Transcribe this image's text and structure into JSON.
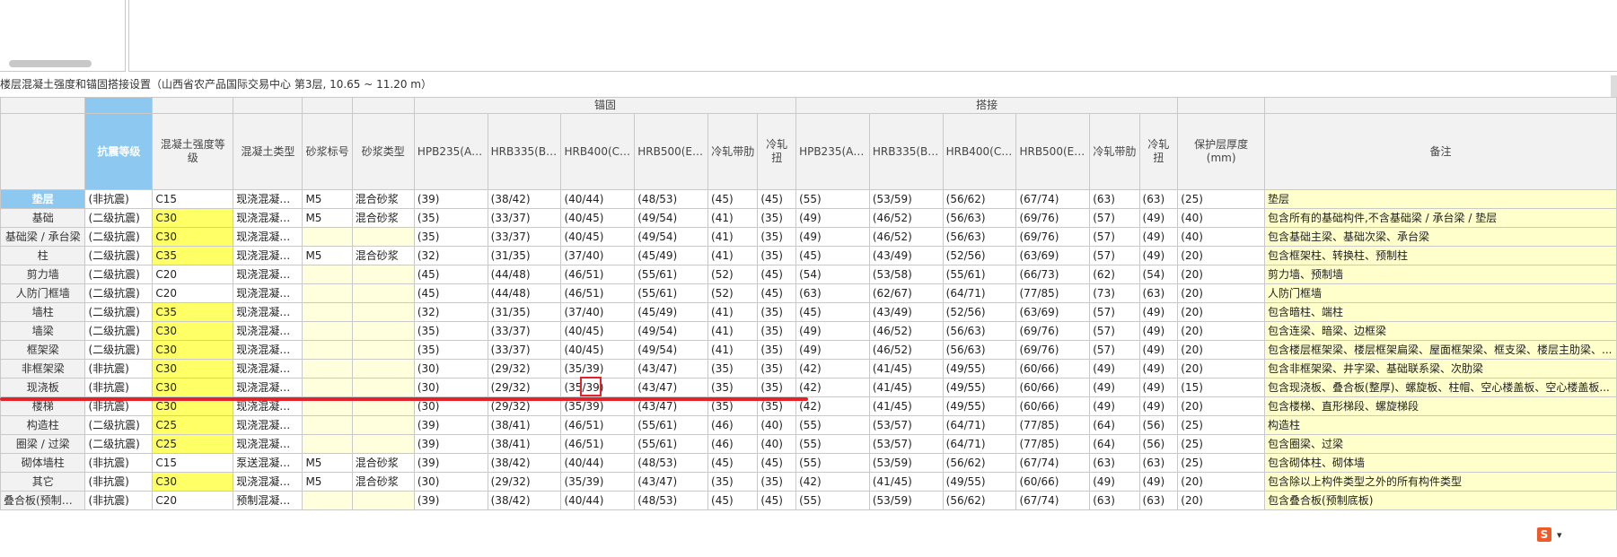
{
  "caption": "楼层混凝土强度和锚固搭接设置（山西省农产品国际交易中心  第3层, 10.65 ~ 11.20 m）",
  "headers": {
    "anchor_group": "锚固",
    "lap_group": "搭接",
    "seismic": "抗震等级",
    "concrete_grade": "混凝土强度等级",
    "concrete_type": "混凝土类型",
    "mortar_grade": "砂浆标号",
    "mortar_type": "砂浆类型",
    "anchor_cols": [
      "HPB235(A)...",
      "HRB335(B)...",
      "HRB400(C)...",
      "HRB500(E)...",
      "冷轧带肋",
      "冷轧扭"
    ],
    "lap_cols": [
      "HPB235(A)...",
      "HRB335(B)...",
      "HRB400(C)...",
      "HRB500(E)...",
      "冷轧带肋",
      "冷轧扭"
    ],
    "cover": "保护层厚度(mm)",
    "note": "备注"
  },
  "rows": [
    {
      "name": "垫层",
      "seismic": "(非抗震)",
      "grade": "C15",
      "ctype": "现浇混凝土...",
      "mortar": "M5",
      "mtype": "混合砂浆",
      "anchor": [
        "(39)",
        "(38/42)",
        "(40/44)",
        "(48/53)",
        "(45)",
        "(45)"
      ],
      "lap": [
        "(55)",
        "(53/59)",
        "(56/62)",
        "(67/74)",
        "(63)",
        "(63)"
      ],
      "cover": "(25)",
      "note": "垫层"
    },
    {
      "name": "基础",
      "seismic": "(二级抗震)",
      "grade": "C30",
      "ctype": "现浇混凝土...",
      "mortar": "M5",
      "mtype": "混合砂浆",
      "anchor": [
        "(35)",
        "(33/37)",
        "(40/45)",
        "(49/54)",
        "(41)",
        "(35)"
      ],
      "lap": [
        "(49)",
        "(46/52)",
        "(56/63)",
        "(69/76)",
        "(57)",
        "(49)"
      ],
      "cover": "(40)",
      "note": "包含所有的基础构件,不含基础梁 / 承台梁 / 垫层"
    },
    {
      "name": "基础梁 / 承台梁",
      "seismic": "(二级抗震)",
      "grade": "C30",
      "ctype": "现浇混凝土...",
      "mortar": "",
      "mtype": "",
      "anchor": [
        "(35)",
        "(33/37)",
        "(40/45)",
        "(49/54)",
        "(41)",
        "(35)"
      ],
      "lap": [
        "(49)",
        "(46/52)",
        "(56/63)",
        "(69/76)",
        "(57)",
        "(49)"
      ],
      "cover": "(40)",
      "note": "包含基础主梁、基础次梁、承台梁"
    },
    {
      "name": "柱",
      "seismic": "(二级抗震)",
      "grade": "C35",
      "ctype": "现浇混凝土...",
      "mortar": "M5",
      "mtype": "混合砂浆",
      "anchor": [
        "(32)",
        "(31/35)",
        "(37/40)",
        "(45/49)",
        "(41)",
        "(35)"
      ],
      "lap": [
        "(45)",
        "(43/49)",
        "(52/56)",
        "(63/69)",
        "(57)",
        "(49)"
      ],
      "cover": "(20)",
      "note": "包含框架柱、转换柱、预制柱"
    },
    {
      "name": "剪力墙",
      "seismic": "(二级抗震)",
      "grade": "C20",
      "ctype": "现浇混凝土...",
      "mortar": "",
      "mtype": "",
      "anchor": [
        "(45)",
        "(44/48)",
        "(46/51)",
        "(55/61)",
        "(52)",
        "(45)"
      ],
      "lap": [
        "(54)",
        "(53/58)",
        "(55/61)",
        "(66/73)",
        "(62)",
        "(54)"
      ],
      "cover": "(20)",
      "note": "剪力墙、预制墙"
    },
    {
      "name": "人防门框墙",
      "seismic": "(二级抗震)",
      "grade": "C20",
      "ctype": "现浇混凝土...",
      "mortar": "",
      "mtype": "",
      "anchor": [
        "(45)",
        "(44/48)",
        "(46/51)",
        "(55/61)",
        "(52)",
        "(45)"
      ],
      "lap": [
        "(63)",
        "(62/67)",
        "(64/71)",
        "(77/85)",
        "(73)",
        "(63)"
      ],
      "cover": "(20)",
      "note": "人防门框墙"
    },
    {
      "name": "墙柱",
      "seismic": "(二级抗震)",
      "grade": "C35",
      "ctype": "现浇混凝土...",
      "mortar": "",
      "mtype": "",
      "anchor": [
        "(32)",
        "(31/35)",
        "(37/40)",
        "(45/49)",
        "(41)",
        "(35)"
      ],
      "lap": [
        "(45)",
        "(43/49)",
        "(52/56)",
        "(63/69)",
        "(57)",
        "(49)"
      ],
      "cover": "(20)",
      "note": "包含暗柱、端柱"
    },
    {
      "name": "墙梁",
      "seismic": "(二级抗震)",
      "grade": "C30",
      "ctype": "现浇混凝土...",
      "mortar": "",
      "mtype": "",
      "anchor": [
        "(35)",
        "(33/37)",
        "(40/45)",
        "(49/54)",
        "(41)",
        "(35)"
      ],
      "lap": [
        "(49)",
        "(46/52)",
        "(56/63)",
        "(69/76)",
        "(57)",
        "(49)"
      ],
      "cover": "(20)",
      "note": "包含连梁、暗梁、边框梁"
    },
    {
      "name": "框架梁",
      "seismic": "(二级抗震)",
      "grade": "C30",
      "ctype": "现浇混凝土...",
      "mortar": "",
      "mtype": "",
      "anchor": [
        "(35)",
        "(33/37)",
        "(40/45)",
        "(49/54)",
        "(41)",
        "(35)"
      ],
      "lap": [
        "(49)",
        "(46/52)",
        "(56/63)",
        "(69/76)",
        "(57)",
        "(49)"
      ],
      "cover": "(20)",
      "note": "包含楼层框架梁、楼层框架扁梁、屋面框架梁、框支梁、楼层主肋梁、..."
    },
    {
      "name": "非框架梁",
      "seismic": "(非抗震)",
      "grade": "C30",
      "ctype": "现浇混凝土...",
      "mortar": "",
      "mtype": "",
      "anchor": [
        "(30)",
        "(29/32)",
        "(35/39)",
        "(43/47)",
        "(35)",
        "(35)"
      ],
      "lap": [
        "(42)",
        "(41/45)",
        "(49/55)",
        "(60/66)",
        "(49)",
        "(49)"
      ],
      "cover": "(20)",
      "note": "包含非框架梁、井字梁、基础联系梁、次肋梁"
    },
    {
      "name": "现浇板",
      "seismic": "(非抗震)",
      "grade": "C30",
      "ctype": "现浇混凝土...",
      "mortar": "",
      "mtype": "",
      "anchor": [
        "(30)",
        "(29/32)",
        "(35/39)",
        "(43/47)",
        "(35)",
        "(35)"
      ],
      "lap": [
        "(42)",
        "(41/45)",
        "(49/55)",
        "(60/66)",
        "(49)",
        "(49)"
      ],
      "cover": "(15)",
      "note": "包含现浇板、叠合板(整厚)、螺旋板、柱帽、空心楼盖板、空心楼盖板..."
    },
    {
      "name": "楼梯",
      "seismic": "(非抗震)",
      "grade": "C30",
      "ctype": "现浇混凝土...",
      "mortar": "",
      "mtype": "",
      "anchor": [
        "(30)",
        "(29/32)",
        "(35/39)",
        "(43/47)",
        "(35)",
        "(35)"
      ],
      "lap": [
        "(42)",
        "(41/45)",
        "(49/55)",
        "(60/66)",
        "(49)",
        "(49)"
      ],
      "cover": "(20)",
      "note": "包含楼梯、直形梯段、螺旋梯段"
    },
    {
      "name": "构造柱",
      "seismic": "(二级抗震)",
      "grade": "C25",
      "ctype": "现浇混凝土...",
      "mortar": "",
      "mtype": "",
      "anchor": [
        "(39)",
        "(38/41)",
        "(46/51)",
        "(55/61)",
        "(46)",
        "(40)"
      ],
      "lap": [
        "(55)",
        "(53/57)",
        "(64/71)",
        "(77/85)",
        "(64)",
        "(56)"
      ],
      "cover": "(25)",
      "note": "构造柱"
    },
    {
      "name": "圈梁 / 过梁",
      "seismic": "(二级抗震)",
      "grade": "C25",
      "ctype": "现浇混凝土...",
      "mortar": "",
      "mtype": "",
      "anchor": [
        "(39)",
        "(38/41)",
        "(46/51)",
        "(55/61)",
        "(46)",
        "(40)"
      ],
      "lap": [
        "(55)",
        "(53/57)",
        "(64/71)",
        "(77/85)",
        "(64)",
        "(56)"
      ],
      "cover": "(25)",
      "note": "包含圈梁、过梁"
    },
    {
      "name": "砌体墙柱",
      "seismic": "(非抗震)",
      "grade": "C15",
      "ctype": "泵送混凝土...",
      "mortar": "M5",
      "mtype": "混合砂浆",
      "anchor": [
        "(39)",
        "(38/42)",
        "(40/44)",
        "(48/53)",
        "(45)",
        "(45)"
      ],
      "lap": [
        "(55)",
        "(53/59)",
        "(56/62)",
        "(67/74)",
        "(63)",
        "(63)"
      ],
      "cover": "(25)",
      "note": "包含砌体柱、砌体墙"
    },
    {
      "name": "其它",
      "seismic": "(非抗震)",
      "grade": "C30",
      "ctype": "现浇混凝土...",
      "mortar": "M5",
      "mtype": "混合砂浆",
      "anchor": [
        "(30)",
        "(29/32)",
        "(35/39)",
        "(43/47)",
        "(35)",
        "(35)"
      ],
      "lap": [
        "(42)",
        "(41/45)",
        "(49/55)",
        "(60/66)",
        "(49)",
        "(49)"
      ],
      "cover": "(20)",
      "note": "包含除以上构件类型之外的所有构件类型"
    },
    {
      "name": "叠合板(预制底板)",
      "seismic": "(非抗震)",
      "grade": "C20",
      "ctype": "预制混凝土...",
      "mortar": "",
      "mtype": "",
      "anchor": [
        "(39)",
        "(38/42)",
        "(40/44)",
        "(48/53)",
        "(45)",
        "(45)"
      ],
      "lap": [
        "(55)",
        "(53/59)",
        "(56/62)",
        "(67/74)",
        "(63)",
        "(63)"
      ],
      "cover": "(20)",
      "note": "包含叠合板(预制底板)"
    }
  ],
  "highlight_grade_rows": [
    1,
    2,
    3,
    6,
    7,
    8,
    9,
    10,
    11,
    12,
    13,
    15
  ],
  "selected_row": 0,
  "ime_icon": "sogou-ime-icon",
  "colors": {
    "highlight_header": "#8cc8f0",
    "yellow": "#ffff66",
    "note_bg": "#ffffcc",
    "annotation_red": "#e5222a"
  }
}
